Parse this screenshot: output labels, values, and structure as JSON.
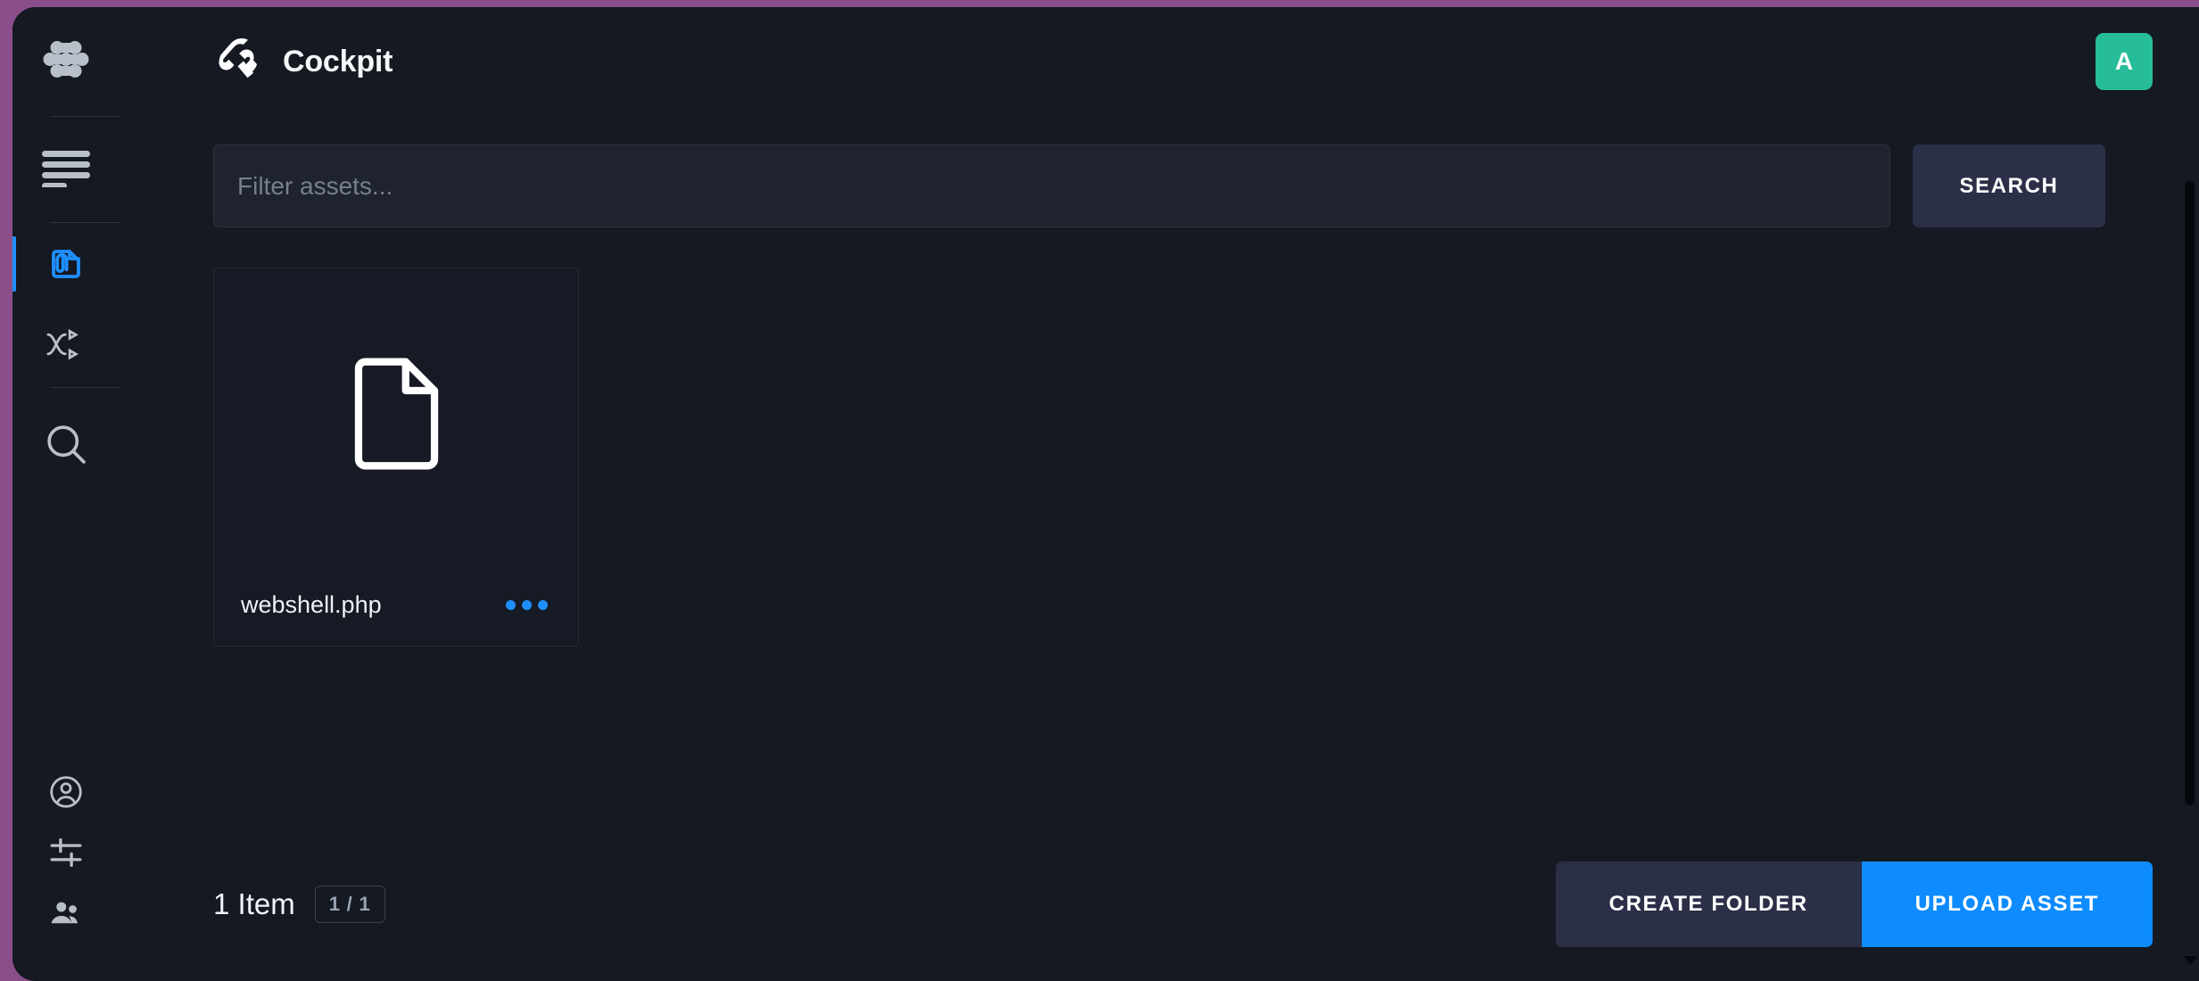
{
  "app": {
    "title": "Cockpit",
    "logo_icon": "cockpit-logo-icon",
    "frame_color": "#8a4f8a",
    "background": "#151922"
  },
  "sidebar": {
    "brand_icon": "cockpit-nodes-logo-icon",
    "menu": {
      "label": "Menu",
      "icon": "hamburger-menu-icon"
    },
    "items": [
      {
        "id": "assets",
        "label": "Assets",
        "icon": "document-paperclip-icon",
        "active": true,
        "color": "#1f8fff"
      },
      {
        "id": "workflows",
        "label": "Workflows",
        "icon": "shuffle-arrows-icon",
        "active": false
      },
      {
        "id": "search",
        "label": "Search",
        "icon": "magnifier-search-icon",
        "active": false
      }
    ],
    "bottom_items": [
      {
        "id": "account",
        "label": "Account",
        "icon": "account-circle-icon"
      },
      {
        "id": "settings",
        "label": "Settings",
        "icon": "sliders-settings-icon"
      },
      {
        "id": "users",
        "label": "Users",
        "icon": "people-users-icon"
      }
    ]
  },
  "header": {
    "title": "Cockpit",
    "avatar": {
      "initial": "A",
      "color": "#28bd9a"
    }
  },
  "search": {
    "placeholder": "Filter assets...",
    "value": "",
    "button_label": "SEARCH"
  },
  "assets": {
    "items": [
      {
        "name": "webshell.php",
        "icon": "file-document-icon",
        "menu_icon": "more-options-dots-icon"
      }
    ]
  },
  "footer": {
    "count_label": "1 Item",
    "page_badge": "1 / 1",
    "create_folder_label": "CREATE FOLDER",
    "upload_asset_label": "UPLOAD ASSET",
    "upload_color": "#0d8bff"
  }
}
